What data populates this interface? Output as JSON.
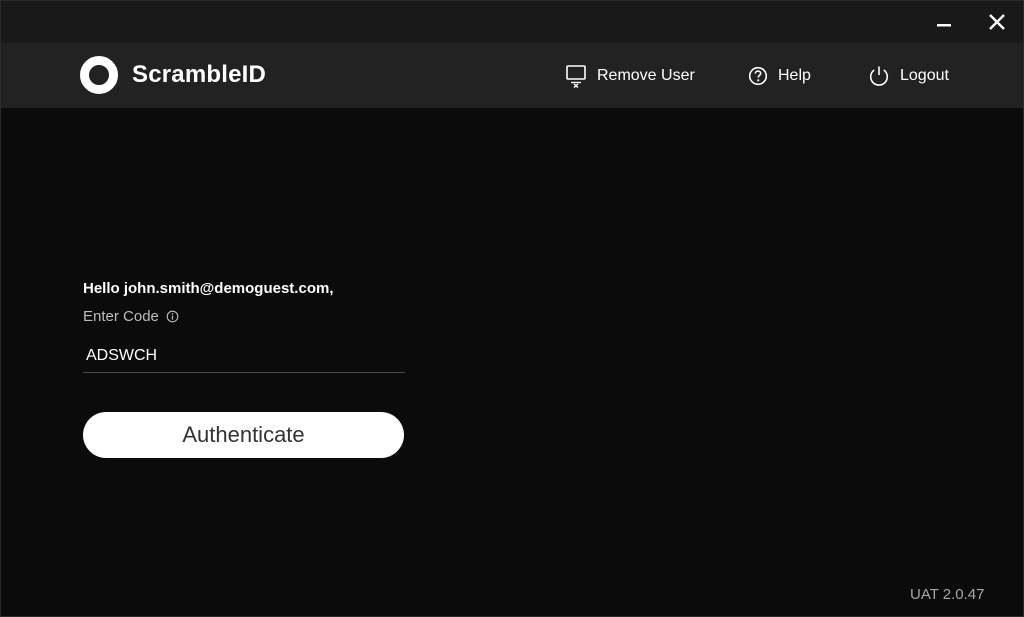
{
  "app": {
    "name": "ScrambleID",
    "version": "UAT 2.0.47"
  },
  "window_controls": {
    "minimize": "minimize-icon",
    "close": "close-icon"
  },
  "nav": {
    "remove_user": {
      "label": "Remove User",
      "icon": "remove-user-icon"
    },
    "help": {
      "label": "Help",
      "icon": "help-icon"
    },
    "logout": {
      "label": "Logout",
      "icon": "power-icon"
    }
  },
  "form": {
    "greeting": "Hello john.smith@demoguest.com,",
    "code_label": "Enter Code",
    "code_value": "ADSWCH",
    "submit_label": "Authenticate"
  },
  "colors": {
    "background": "#0b0b0b",
    "titlebar": "#191919",
    "header": "#222222",
    "button": "#ffffff",
    "button_text": "#333333"
  }
}
